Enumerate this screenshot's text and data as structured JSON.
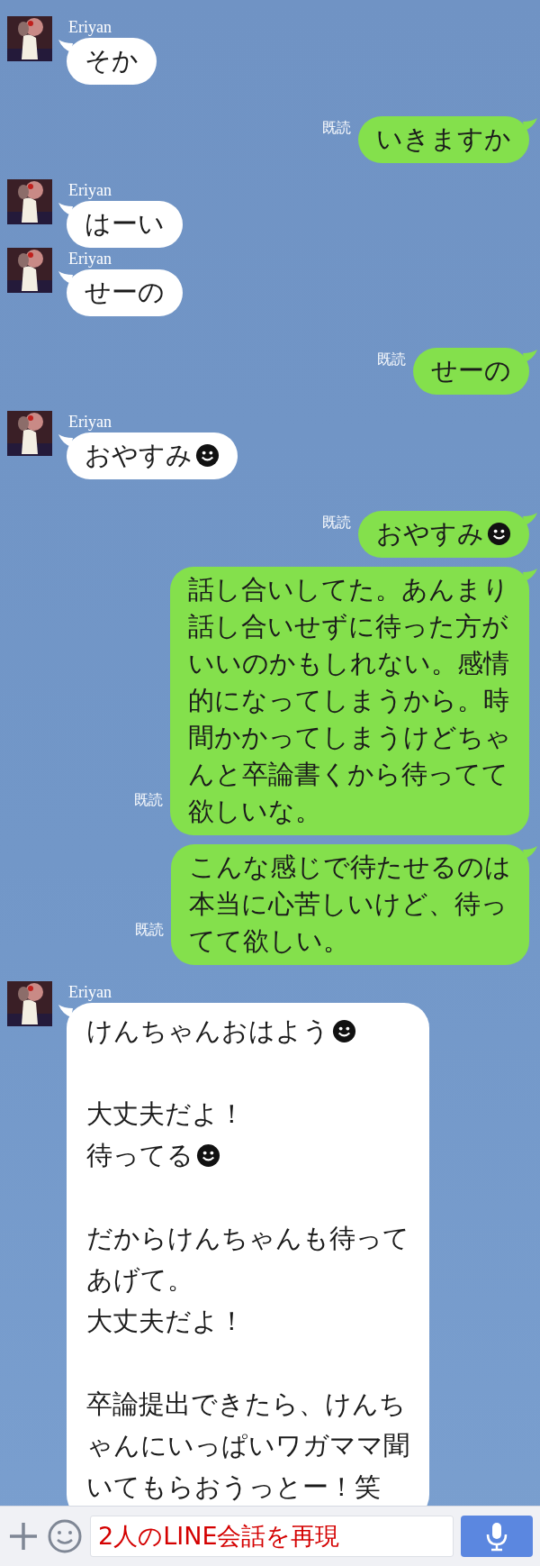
{
  "messages": [
    {
      "kind": "incoming",
      "sender": "Eriyan",
      "paragraphs": [
        [
          {
            "text": "そか",
            "emoji": false
          }
        ]
      ]
    },
    {
      "kind": "outgoing",
      "read_label": "既読",
      "paragraphs": [
        [
          {
            "text": "いきますか",
            "emoji": false
          }
        ]
      ]
    },
    {
      "kind": "incoming",
      "sender": "Eriyan",
      "paragraphs": [
        [
          {
            "text": "はーい",
            "emoji": false
          }
        ]
      ]
    },
    {
      "kind": "incoming",
      "sender": "Eriyan",
      "paragraphs": [
        [
          {
            "text": "せーの",
            "emoji": false
          }
        ]
      ]
    },
    {
      "kind": "outgoing",
      "read_label": "既読",
      "paragraphs": [
        [
          {
            "text": "せーの",
            "emoji": false
          }
        ]
      ]
    },
    {
      "kind": "incoming",
      "sender": "Eriyan",
      "paragraphs": [
        [
          {
            "text": "おやすみ",
            "emoji": true
          }
        ]
      ]
    },
    {
      "kind": "outgoing",
      "read_label": "既読",
      "paragraphs": [
        [
          {
            "text": "おやすみ",
            "emoji": true
          }
        ]
      ]
    },
    {
      "kind": "outgoing",
      "read_label": "既読",
      "paragraphs": [
        [
          {
            "text": "話し合いしてた。あんまり",
            "emoji": false
          },
          {
            "text": "話し合いせずに待った方が",
            "emoji": false
          },
          {
            "text": "いいのかもしれない。感情",
            "emoji": false
          },
          {
            "text": "的になってしまうから。時",
            "emoji": false
          },
          {
            "text": "間かかってしまうけどちゃ",
            "emoji": false
          },
          {
            "text": "んと卒論書くから待ってて",
            "emoji": false
          },
          {
            "text": "欲しいな。",
            "emoji": false
          }
        ]
      ]
    },
    {
      "kind": "outgoing",
      "read_label": "既読",
      "paragraphs": [
        [
          {
            "text": "こんな感じで待たせるのは",
            "emoji": false
          },
          {
            "text": "本当に心苦しいけど、待っ",
            "emoji": false
          },
          {
            "text": "てて欲しい。",
            "emoji": false
          }
        ]
      ]
    },
    {
      "kind": "incoming",
      "sender": "Eriyan",
      "paragraphs": [
        [
          {
            "text": "けんちゃんおはよう",
            "emoji": true
          }
        ],
        [
          {
            "text": "大丈夫だよ！",
            "emoji": false
          },
          {
            "text": "待ってる",
            "emoji": true
          }
        ],
        [
          {
            "text": "だからけんちゃんも待って",
            "emoji": false
          },
          {
            "text": "あげて。",
            "emoji": false
          },
          {
            "text": "大丈夫だよ！",
            "emoji": false
          }
        ],
        [
          {
            "text": "卒論提出できたら、けんち",
            "emoji": false
          },
          {
            "text": "ゃんにいっぱいワガママ聞",
            "emoji": false
          },
          {
            "text": "いてもらおうっとー！笑",
            "emoji": false
          }
        ]
      ]
    }
  ],
  "composer": {
    "value": "2人のLINE会話を再現"
  }
}
